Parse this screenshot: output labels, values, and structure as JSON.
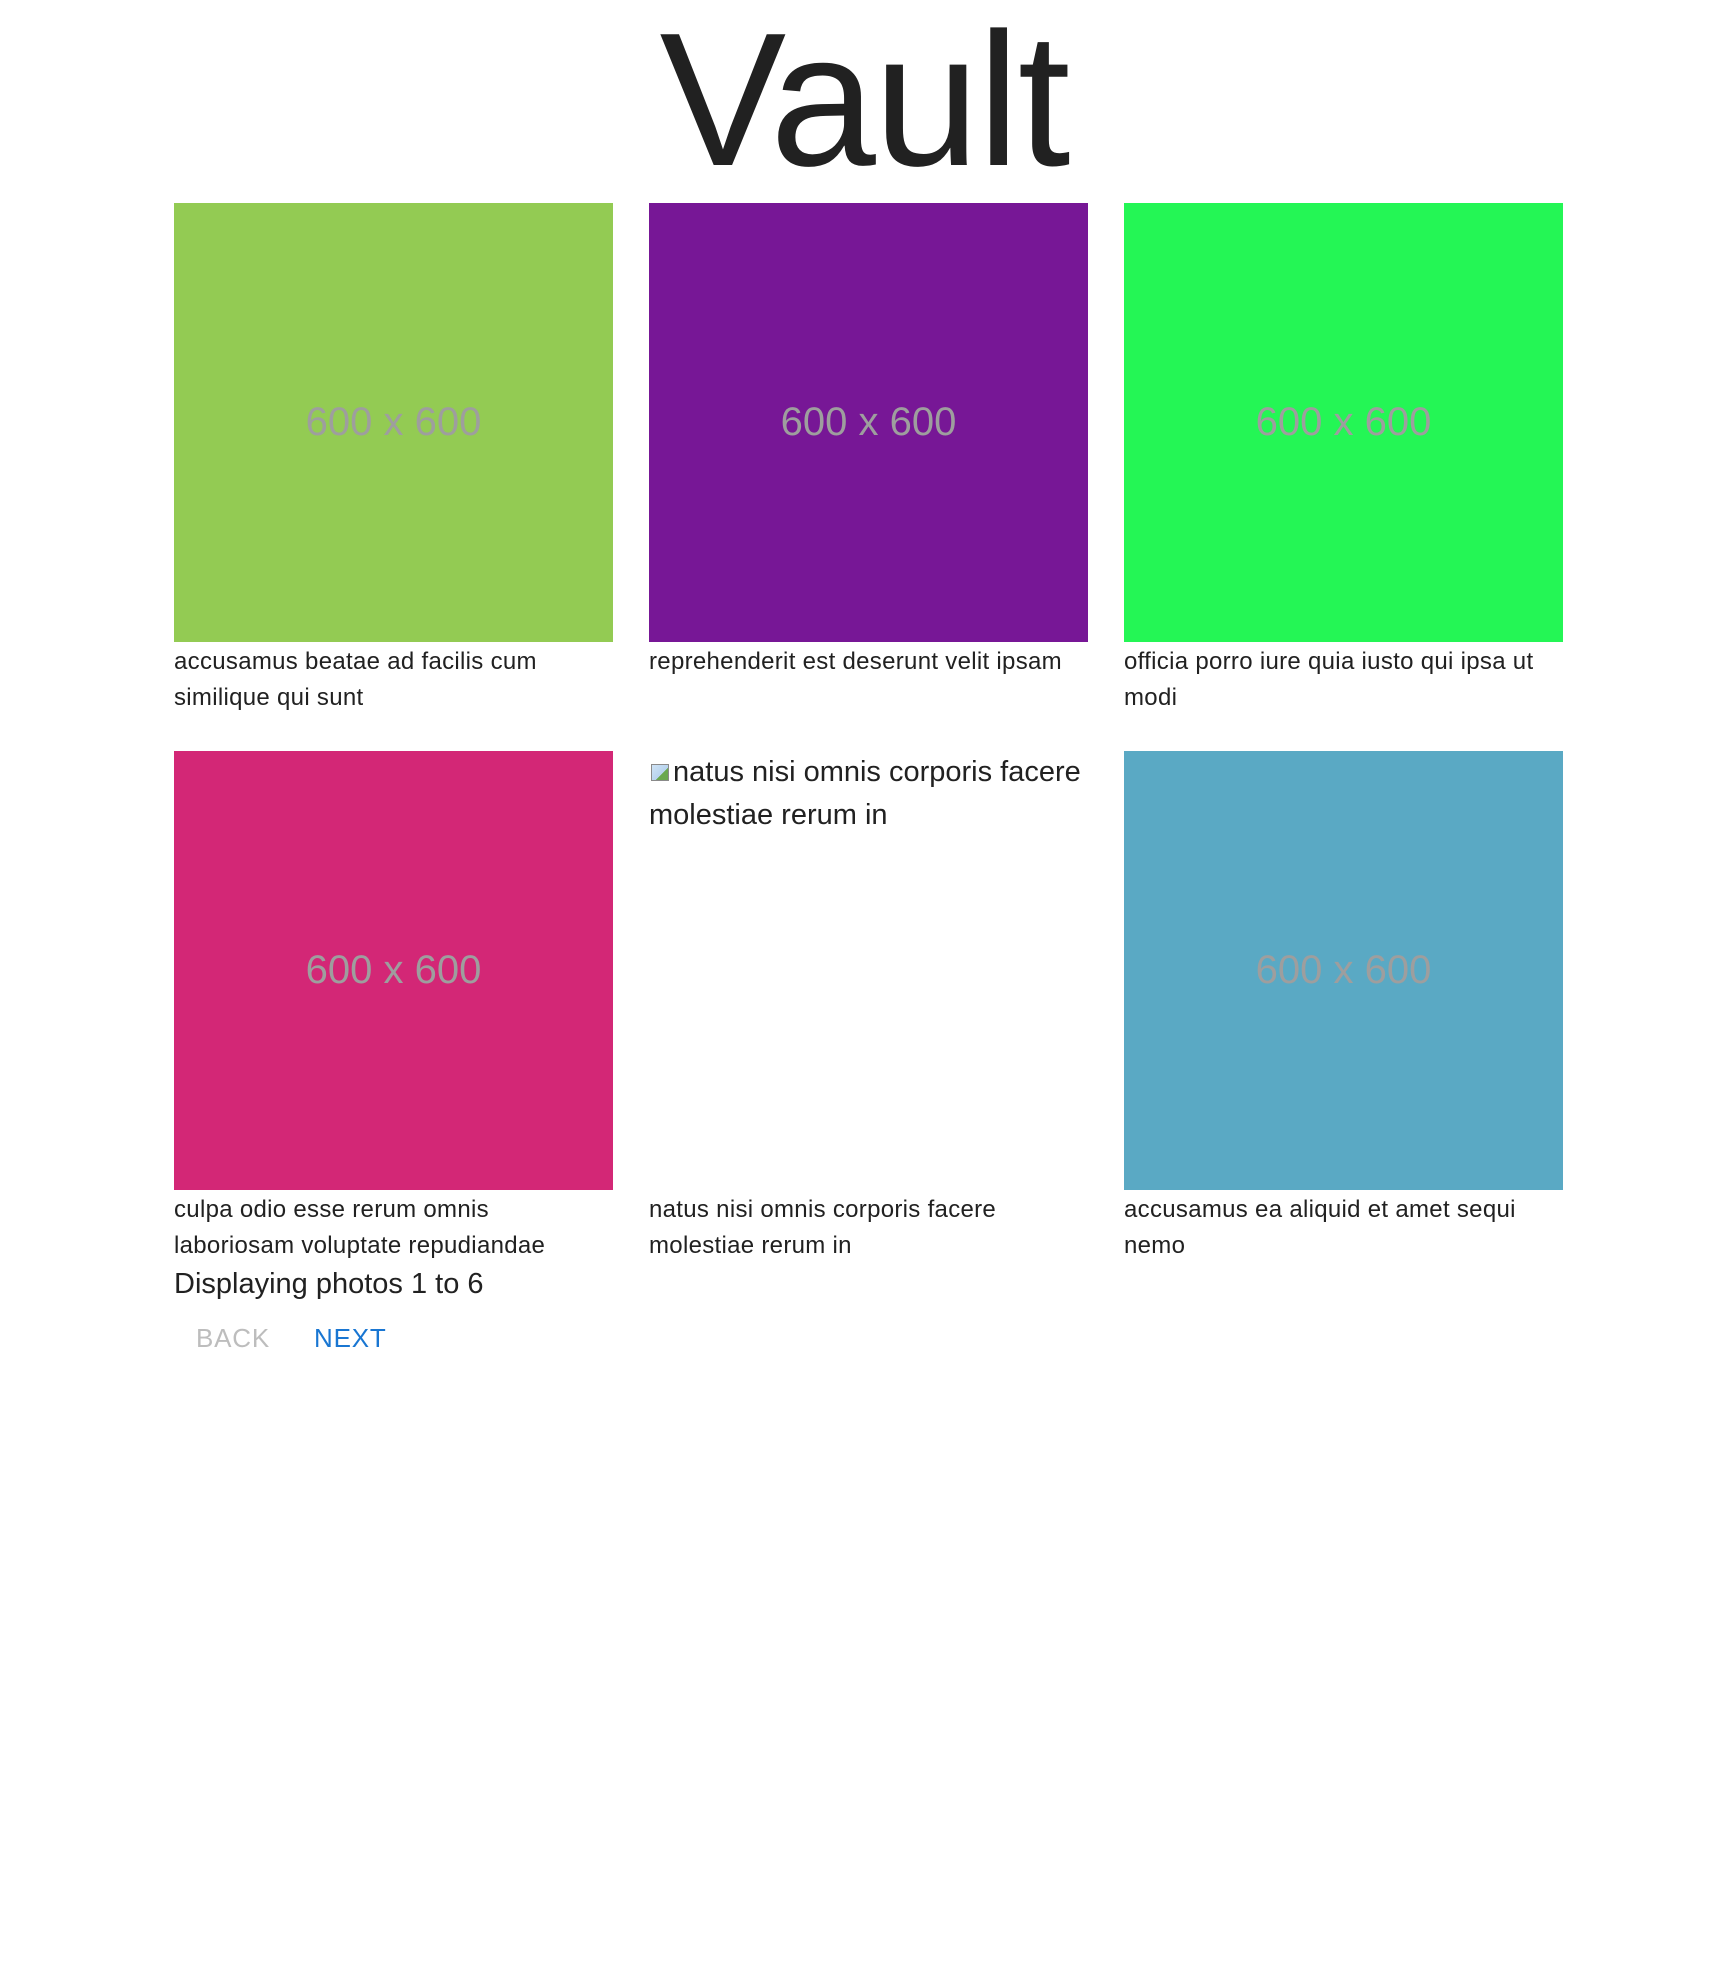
{
  "header": {
    "title": "Vault"
  },
  "photos": [
    {
      "placeholder_text": "600 x 600",
      "color": "#93cb53",
      "text_color": "#9e9e9e",
      "caption": "accusamus beatae ad facilis cum similique qui sunt",
      "loaded": true
    },
    {
      "placeholder_text": "600 x 600",
      "color": "#771796",
      "text_color": "#9e9e9e",
      "caption": "reprehenderit est deserunt velit ipsam",
      "loaded": true
    },
    {
      "placeholder_text": "600 x 600",
      "color": "#24f655",
      "text_color": "#9e9e9e",
      "caption": "officia porro iure quia iusto qui ipsa ut modi",
      "loaded": true
    },
    {
      "placeholder_text": "600 x 600",
      "color": "#d32776",
      "text_color": "#9e9e9e",
      "caption": "culpa odio esse rerum omnis laboriosam voluptate repudiandae",
      "loaded": true
    },
    {
      "alt_text": "natus nisi omnis corporis facere molestiae rerum in",
      "caption": "natus nisi omnis corporis facere molestiae rerum in",
      "loaded": false
    },
    {
      "placeholder_text": "600 x 600",
      "color": "#5aa9c4",
      "text_color": "#9e9e9e",
      "caption": "accusamus ea aliquid et amet sequi nemo",
      "loaded": true
    }
  ],
  "status": {
    "text": "Displaying photos 1 to 6"
  },
  "pagination": {
    "back_label": "BACK",
    "next_label": "NEXT",
    "back_disabled": true,
    "accent_color": "#1976d2"
  }
}
